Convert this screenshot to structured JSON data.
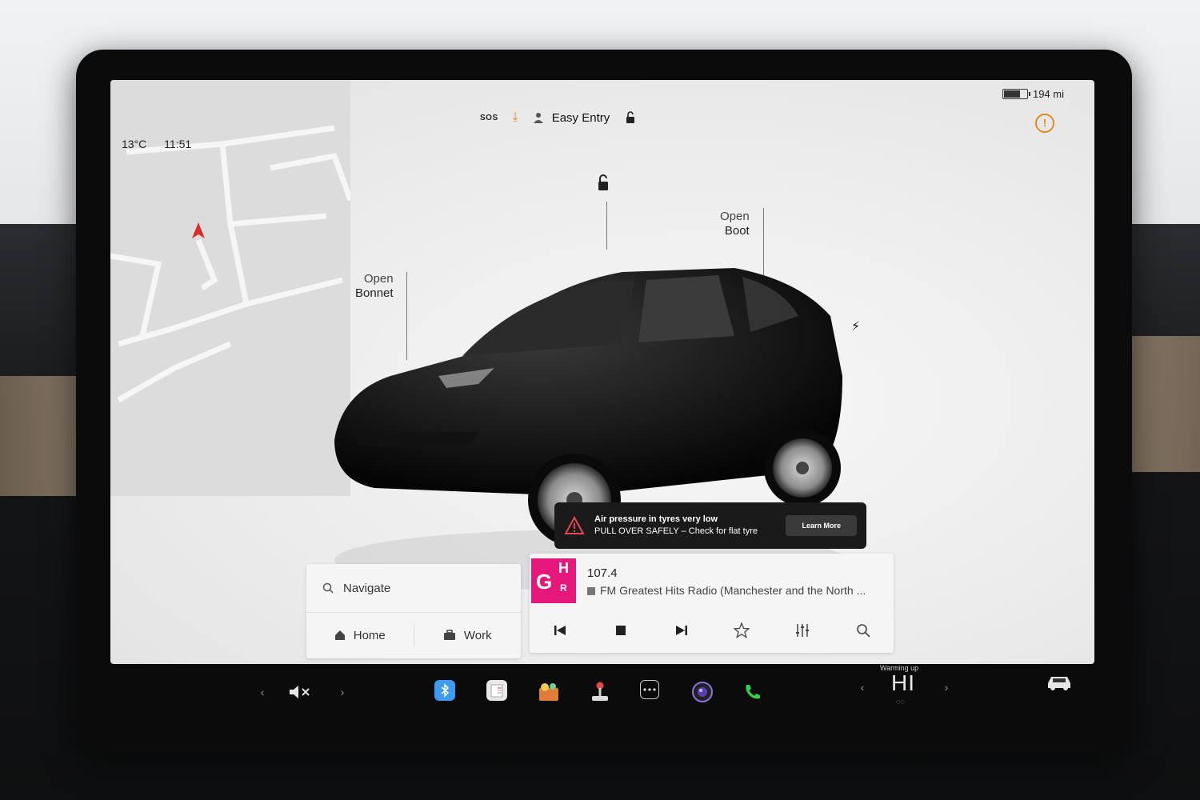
{
  "status": {
    "temperature": "13°C",
    "time": "11:51",
    "sos": "SOS",
    "profile": "Easy Entry",
    "range": "194 mi"
  },
  "car_controls": {
    "bonnet_open": "Open",
    "bonnet_label": "Bonnet",
    "boot_open": "Open",
    "boot_label": "Boot"
  },
  "alert": {
    "title": "Air pressure in tyres very low",
    "message": "PULL OVER SAFELY – Check for flat tyre",
    "button": "Learn More"
  },
  "navigation": {
    "search": "Navigate",
    "home": "Home",
    "work": "Work"
  },
  "media": {
    "frequency": "107.4",
    "station": "FM Greatest Hits Radio (Manchester and the North ..."
  },
  "climate": {
    "status": "Warming up",
    "temp": "HI"
  },
  "colors": {
    "accent_orange": "#e08a1e",
    "alert_bg": "#1a1a1a",
    "radio_logo": "#e5177b",
    "bluetooth": "#3d9bf0",
    "phone": "#2fcf4f"
  }
}
